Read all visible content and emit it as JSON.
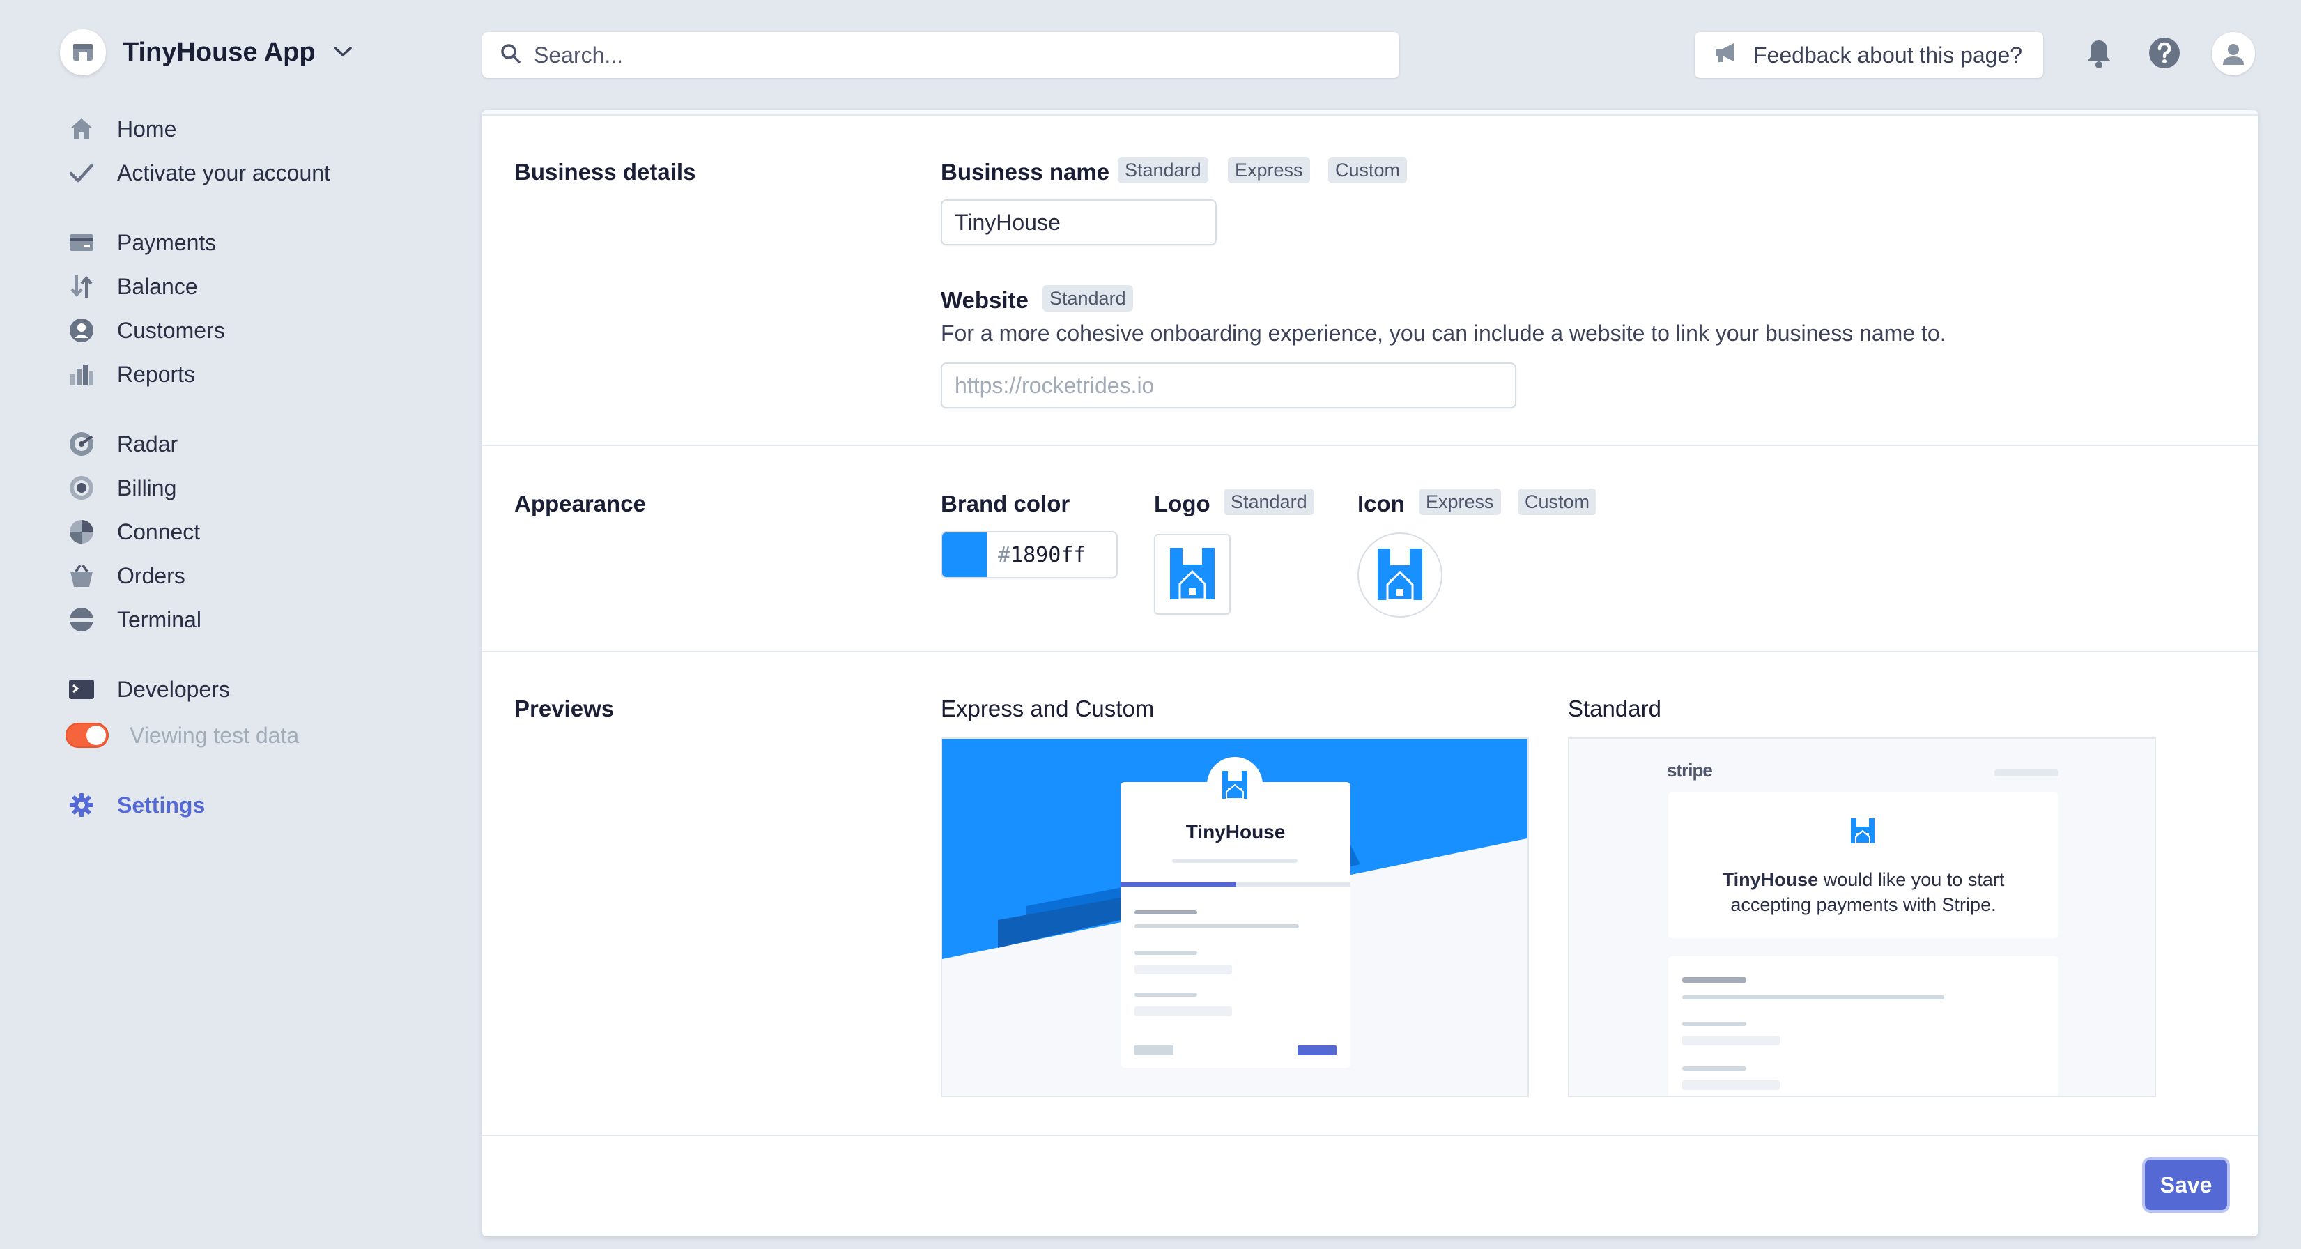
{
  "app": {
    "name": "TinyHouse App"
  },
  "sidebar": {
    "items": [
      {
        "label": "Home",
        "icon": "home-icon"
      },
      {
        "label": "Activate your account",
        "icon": "check-icon"
      },
      {
        "label": "Payments",
        "icon": "payments-icon"
      },
      {
        "label": "Balance",
        "icon": "balance-icon"
      },
      {
        "label": "Customers",
        "icon": "customers-icon"
      },
      {
        "label": "Reports",
        "icon": "reports-icon"
      },
      {
        "label": "Radar",
        "icon": "radar-icon"
      },
      {
        "label": "Billing",
        "icon": "billing-icon"
      },
      {
        "label": "Connect",
        "icon": "connect-icon"
      },
      {
        "label": "Orders",
        "icon": "orders-icon"
      },
      {
        "label": "Terminal",
        "icon": "terminal-icon"
      },
      {
        "label": "Developers",
        "icon": "developers-icon"
      },
      {
        "label": "Viewing test data",
        "icon": "toggle"
      },
      {
        "label": "Settings",
        "icon": "gear-icon"
      }
    ],
    "test_data_enabled": true
  },
  "topbar": {
    "search_placeholder": "Search...",
    "feedback_label": "Feedback about this page?"
  },
  "business_details": {
    "section_title": "Business details",
    "business_name_label": "Business name",
    "business_name_badges": [
      "Standard",
      "Express",
      "Custom"
    ],
    "business_name_value": "TinyHouse",
    "website_label": "Website",
    "website_badges": [
      "Standard"
    ],
    "website_help": "For a more cohesive onboarding experience, you can include a website to link your business name to.",
    "website_placeholder": "https://rocketrides.io"
  },
  "appearance": {
    "section_title": "Appearance",
    "brand_color_label": "Brand color",
    "brand_color_hash": "#",
    "brand_color_value": "1890ff",
    "brand_color": "#1890ff",
    "logo_label": "Logo",
    "logo_badges": [
      "Standard"
    ],
    "icon_label": "Icon",
    "icon_badges": [
      "Express",
      "Custom"
    ]
  },
  "previews": {
    "section_title": "Previews",
    "express_custom_title": "Express and Custom",
    "express_custom_business": "TinyHouse",
    "standard_title": "Standard",
    "standard_brand": "stripe",
    "standard_business": "TinyHouse",
    "standard_message": "would like you to start accepting payments with Stripe."
  },
  "actions": {
    "save_label": "Save"
  },
  "colors": {
    "accent": "#5469d4",
    "brand": "#1890ff",
    "toggle": "#f5643d"
  }
}
